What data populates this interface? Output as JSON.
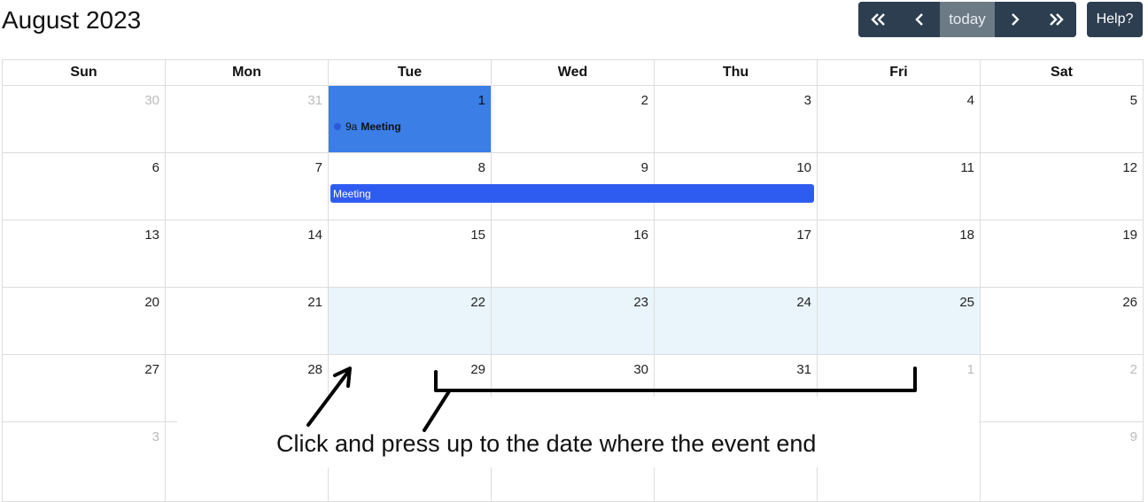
{
  "header": {
    "title": "August 2023",
    "nav": {
      "prev_year_icon": "double-chevron-left-icon",
      "prev_icon": "chevron-left-icon",
      "today_label": "today",
      "next_icon": "chevron-right-icon",
      "next_year_icon": "double-chevron-right-icon"
    },
    "help_label": "Help?"
  },
  "calendar": {
    "weekdays": [
      "Sun",
      "Mon",
      "Tue",
      "Wed",
      "Thu",
      "Fri",
      "Sat"
    ],
    "weeks": [
      [
        "30",
        "31",
        "1",
        "2",
        "3",
        "4",
        "5"
      ],
      [
        "6",
        "7",
        "8",
        "9",
        "10",
        "11",
        "12"
      ],
      [
        "13",
        "14",
        "15",
        "16",
        "17",
        "18",
        "19"
      ],
      [
        "20",
        "21",
        "22",
        "23",
        "24",
        "25",
        "26"
      ],
      [
        "27",
        "28",
        "29",
        "30",
        "31",
        "1",
        "2"
      ],
      [
        "3",
        "",
        "",
        "",
        "",
        "",
        "9"
      ]
    ],
    "events": {
      "timed": {
        "time": "9a",
        "title": "Meeting",
        "dot_color": "#2b5ad6"
      },
      "multi_day": {
        "title": "Meeting",
        "color": "#2f5cf0"
      }
    },
    "colors": {
      "today_bg": "#3a7ee6",
      "highlight_bg": "#e9f5fb",
      "button_bg": "#2c3e50",
      "today_button_bg": "#6c7a86"
    }
  },
  "annotation": {
    "text": "Click and press up to the date where the event end"
  }
}
